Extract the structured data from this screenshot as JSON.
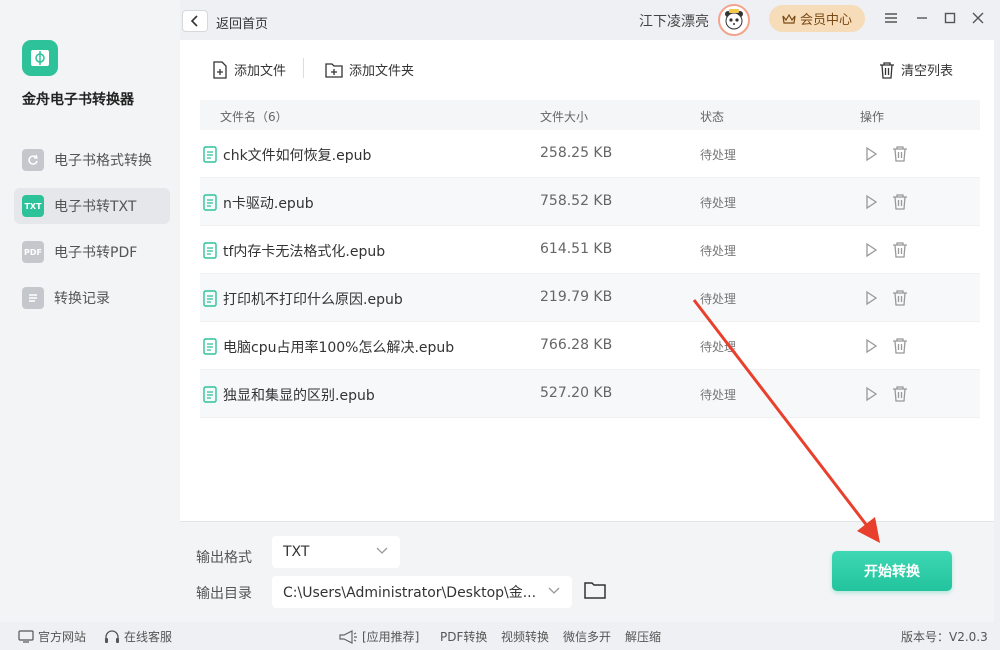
{
  "app": {
    "name": "金舟电子书转换器"
  },
  "sidebar": {
    "items": [
      {
        "label": "电子书格式转换",
        "icon": "refresh-icon",
        "icon_text": ""
      },
      {
        "label": "电子书转TXT",
        "icon": "txt-icon",
        "icon_text": "TXT"
      },
      {
        "label": "电子书转PDF",
        "icon": "pdf-icon",
        "icon_text": "PDF"
      },
      {
        "label": "转换记录",
        "icon": "list-icon",
        "icon_text": ""
      }
    ],
    "active_index": 1
  },
  "topbar": {
    "back_label": "返回首页",
    "username": "江下凌漂亮",
    "vip_label": "会员中心"
  },
  "toolbar": {
    "add_file": "添加文件",
    "add_folder": "添加文件夹",
    "clear_list": "清空列表"
  },
  "table": {
    "headers": {
      "name": "文件名（6）",
      "size": "文件大小",
      "status": "状态",
      "action": "操作"
    },
    "rows": [
      {
        "name": "chk文件如何恢复.epub",
        "size": "258.25 KB",
        "status": "待处理"
      },
      {
        "name": "n卡驱动.epub",
        "size": "758.52 KB",
        "status": "待处理"
      },
      {
        "name": "tf内存卡无法格式化.epub",
        "size": "614.51 KB",
        "status": "待处理"
      },
      {
        "name": "打印机不打印什么原因.epub",
        "size": "219.79 KB",
        "status": "待处理"
      },
      {
        "name": "电脑cpu占用率100%怎么解决.epub",
        "size": "766.28 KB",
        "status": "待处理"
      },
      {
        "name": "独显和集显的区别.epub",
        "size": "527.20 KB",
        "status": "待处理"
      }
    ]
  },
  "output": {
    "format_label": "输出格式",
    "format_value": "TXT",
    "dir_label": "输出目录",
    "dir_value": "C:\\Users\\Administrator\\Desktop\\金...",
    "start_label": "开始转换"
  },
  "statusbar": {
    "website": "官方网站",
    "service": "在线客服",
    "recommend": "[应用推荐]",
    "links": [
      "PDF转换",
      "视频转换",
      "微信多开",
      "解压缩"
    ],
    "version": "版本号：V2.0.3"
  },
  "colors": {
    "accent": "#2ec29a",
    "vip_bg": "#f6dcb8",
    "arrow": "#e8402c"
  }
}
